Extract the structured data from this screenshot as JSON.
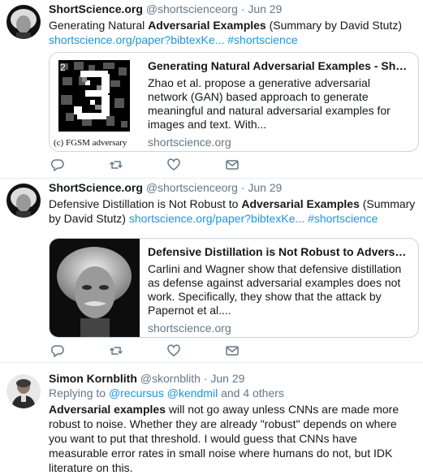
{
  "tweets": [
    {
      "name": "ShortScience.org",
      "handle": "@shortscienceorg",
      "dot": "·",
      "time": "Jun 29",
      "text_parts": [
        "Generating Natural ",
        "Adversarial Examples",
        " (Summary by David Stutz)"
      ],
      "links": [
        "shortscience.org/paper?bibtexKe...",
        "#shortscience"
      ],
      "card": {
        "title": "Generating Natural Adversarial Examples - ShortSc...",
        "description": "Zhao et al. propose a generative adversarial network (GAN) based approach to generate meaningful and natural adversarial examples for images and text. With...",
        "domain": "shortscience.org",
        "image_label_number": "2",
        "image_caption": "(c) FGSM adversary"
      }
    },
    {
      "name": "ShortScience.org",
      "handle": "@shortscienceorg",
      "dot": "·",
      "time": "Jun 29",
      "text_parts": [
        "Defensive Distillation is Not Robust to ",
        "Adversarial Examples",
        " (Summary by David Stutz)"
      ],
      "links": [
        "shortscience.org/paper?bibtexKe...",
        "#shortscience"
      ],
      "card": {
        "title": "Defensive Distillation is Not Robust to Adversarial ...",
        "description": "Carlini and Wagner show that defensive distillation as defense against adversarial examples does not work. Specifically, they show that the attack by Papernot et al....",
        "domain": "shortscience.org"
      }
    },
    {
      "name": "Simon Kornblith",
      "handle": "@skornblith",
      "dot": "·",
      "time": "Jun 29",
      "reply_prefix": "Replying to ",
      "reply_user1": "@recursus",
      "reply_user2": "@kendmil",
      "reply_suffix": " and 4 others",
      "text_bold": "Adversarial examples",
      "text_rest": " will not go away unless CNNs are made more robust to noise. Whether they are already \"robust\" depends on where you want to put that threshold. I would guess that CNNs have measurable error rates in small noise where humans do not, but IDK literature on this."
    }
  ],
  "icons": [
    "reply-icon",
    "retweet-icon",
    "like-icon",
    "dm-icon"
  ],
  "colors": {
    "link": "#1b95e0",
    "muted": "#657786",
    "border": "#e6ecf0",
    "icon": "#657786"
  }
}
